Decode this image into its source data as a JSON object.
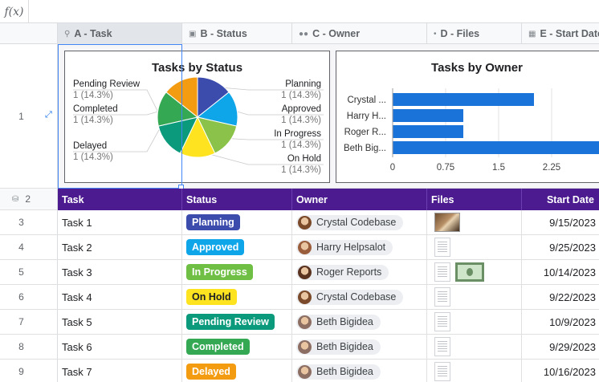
{
  "formula_bar": {
    "fx_label": "f(x)"
  },
  "columns": [
    {
      "letter_label": "A - Task",
      "icon": "key-icon"
    },
    {
      "letter_label": "B - Status",
      "icon": "dropdown-icon"
    },
    {
      "letter_label": "C - Owner",
      "icon": "people-icon"
    },
    {
      "letter_label": "D - Files",
      "icon": "paperclip-icon"
    },
    {
      "letter_label": "E - Start Date",
      "icon": "calendar-icon"
    }
  ],
  "row_numbers": [
    "1",
    "2",
    "3",
    "4",
    "5",
    "6",
    "7",
    "8",
    "9"
  ],
  "table_header": {
    "task": "Task",
    "status": "Status",
    "owner": "Owner",
    "files": "Files",
    "start_date": "Start Date"
  },
  "status_colors": {
    "Planning": "#3c4cad",
    "Approved": "#0ea5e9",
    "In Progress": "#6fbf44",
    "On Hold": "#fde320",
    "Pending Review": "#0c9a7c",
    "Completed": "#34a853",
    "Delayed": "#f39c12"
  },
  "rows": [
    {
      "task": "Task 1",
      "status": "Planning",
      "owner": "Crystal Codebase",
      "files": [
        "photo"
      ],
      "start_date": "9/15/2023"
    },
    {
      "task": "Task 2",
      "status": "Approved",
      "owner": "Harry Helpsalot",
      "files": [
        "doc"
      ],
      "start_date": "9/25/2023"
    },
    {
      "task": "Task 3",
      "status": "In Progress",
      "owner": "Roger Reports",
      "files": [
        "doc",
        "money"
      ],
      "start_date": "10/14/2023"
    },
    {
      "task": "Task 4",
      "status": "On Hold",
      "owner": "Crystal Codebase",
      "files": [
        "doc"
      ],
      "start_date": "9/22/2023"
    },
    {
      "task": "Task 5",
      "status": "Pending Review",
      "owner": "Beth Bigidea",
      "files": [
        "doc"
      ],
      "start_date": "10/9/2023"
    },
    {
      "task": "Task 6",
      "status": "Completed",
      "owner": "Beth Bigidea",
      "files": [
        "doc"
      ],
      "start_date": "9/29/2023"
    },
    {
      "task": "Task 7",
      "status": "Delayed",
      "owner": "Beth Bigidea",
      "files": [
        "doc"
      ],
      "start_date": "10/16/2023"
    }
  ],
  "chart_data": [
    {
      "type": "pie",
      "title": "Tasks by Status",
      "slices": [
        {
          "label": "Planning",
          "value": 1,
          "pct": "1 (14.3%)",
          "color": "#3c4cad"
        },
        {
          "label": "Approved",
          "value": 1,
          "pct": "1 (14.3%)",
          "color": "#0ea5e9"
        },
        {
          "label": "In Progress",
          "value": 1,
          "pct": "1 (14.3%)",
          "color": "#8bc34a"
        },
        {
          "label": "On Hold",
          "value": 1,
          "pct": "1 (14.3%)",
          "color": "#fde320"
        },
        {
          "label": "Pending Review",
          "value": 1,
          "pct": "1 (14.3%)",
          "color": "#0c9a7c"
        },
        {
          "label": "Completed",
          "value": 1,
          "pct": "1 (14.3%)",
          "color": "#34a853"
        },
        {
          "label": "Delayed",
          "value": 1,
          "pct": "1 (14.3%)",
          "color": "#f39c12"
        }
      ]
    },
    {
      "type": "bar",
      "orientation": "horizontal",
      "title": "Tasks by Owner",
      "categories": [
        "Crystal ...",
        "Harry H...",
        "Roger R...",
        "Beth Big..."
      ],
      "values": [
        2,
        1,
        1,
        3
      ],
      "x_ticks": [
        "0",
        "0.75",
        "1.5",
        "2.25"
      ],
      "xlim": [
        0,
        3
      ],
      "color": "#1a73d9",
      "grid": true
    }
  ]
}
